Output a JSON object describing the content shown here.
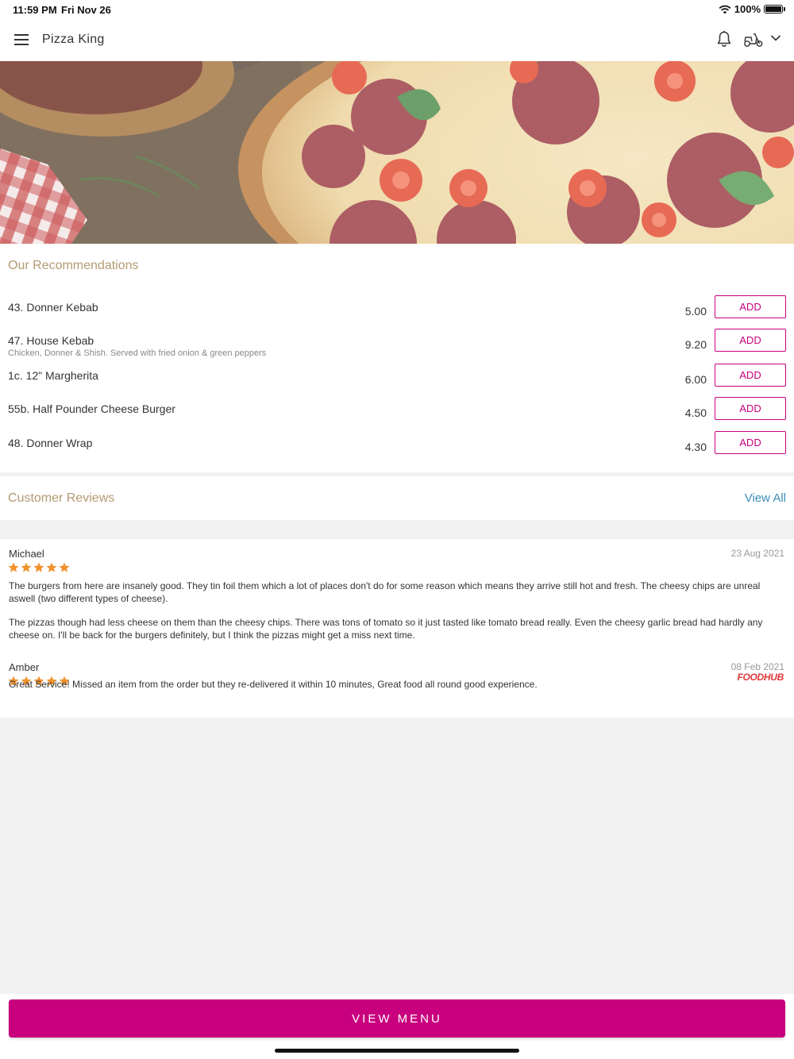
{
  "status_bar": {
    "time": "11:59 PM",
    "date": "Fri Nov 26",
    "battery": "100%"
  },
  "header": {
    "title": "Pizza King",
    "icons": [
      "menu-icon",
      "bell-icon",
      "scooter-icon",
      "chevron-down-icon"
    ]
  },
  "recommendations": {
    "title": "Our Recommendations",
    "add_label": "ADD",
    "items": [
      {
        "name": "43. Donner Kebab",
        "description": "",
        "price": "5.00"
      },
      {
        "name": "47. House Kebab",
        "description": "Chicken, Donner & Shish. Served with fried onion & green peppers",
        "price": "9.20"
      },
      {
        "name": "1c. 12\" Margherita",
        "description": "",
        "price": "6.00"
      },
      {
        "name": "55b. Half Pounder Cheese Burger",
        "description": "",
        "price": "4.50"
      },
      {
        "name": "48. Donner Wrap",
        "description": "",
        "price": "4.30"
      }
    ]
  },
  "reviews": {
    "title": "Customer Reviews",
    "view_all": "View All",
    "items": [
      {
        "name": "Michael",
        "date": "23 Aug 2021",
        "rating": 5,
        "source": "",
        "paragraphs": [
          "The burgers from here are insanely good. They tin foil them which a lot of places don't do for some reason which means they arrive still hot and fresh. The cheesy chips are unreal aswell (two different types of cheese).",
          "The pizzas though had less cheese on them than the cheesy chips. There was tons of tomato so it just tasted like tomato bread really. Even the cheesy garlic bread had hardly any cheese on. I'll be back for the burgers definitely, but I think the pizzas might get a miss next time."
        ]
      },
      {
        "name": "Amber",
        "date": "08 Feb 2021",
        "rating": 5,
        "source": "FOODHUB",
        "paragraphs": [
          "Great Service! Missed an item from the order but they re-delivered it within 10 minutes, Great food all round good experience."
        ]
      }
    ]
  },
  "footer": {
    "view_menu": "VIEW MENU"
  },
  "colors": {
    "accent": "#c8007e",
    "section_title": "#b49a72",
    "link": "#3a8fb7",
    "star": "#f0922e",
    "foodhub": "#e0383a"
  }
}
